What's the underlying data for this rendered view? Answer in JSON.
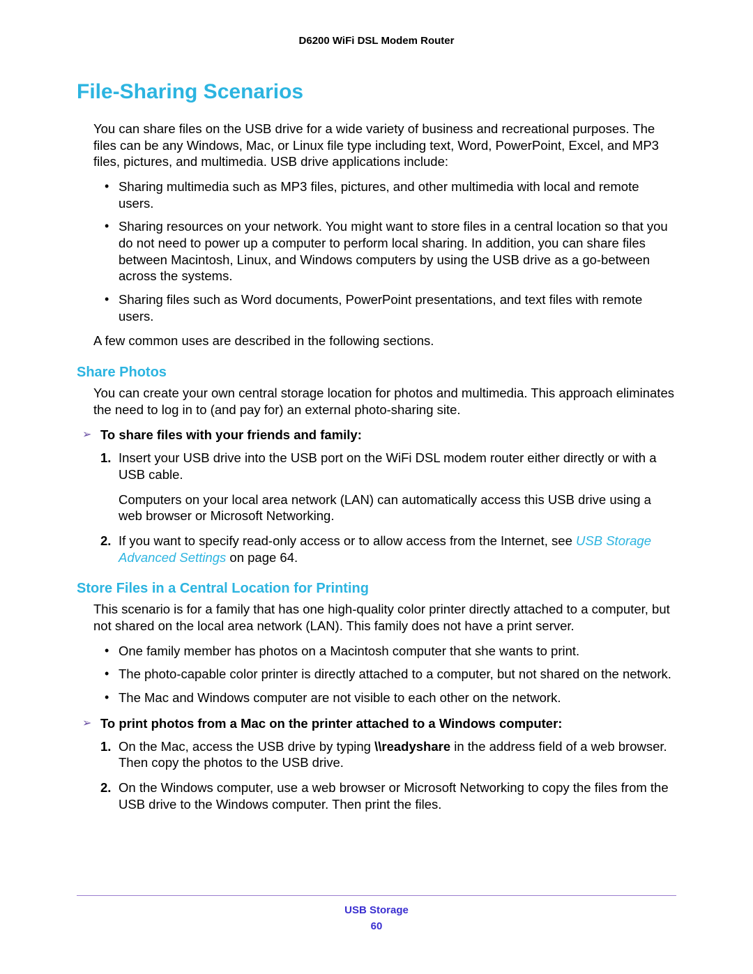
{
  "header": {
    "product": "D6200 WiFi DSL Modem Router"
  },
  "section": {
    "title": "File-Sharing Scenarios",
    "intro": "You can share files on the USB drive for a wide variety of business and recreational purposes. The files can be any Windows, Mac, or Linux file type including text, Word, PowerPoint, Excel, and MP3 files, pictures, and multimedia. USB drive applications include:",
    "bullets": [
      "Sharing multimedia such as MP3 files, pictures, and other multimedia with local and remote users.",
      "Sharing resources on your network. You might want to store files in a central location so that you do not need to power up a computer to perform local sharing. In addition, you can share files between Macintosh, Linux, and Windows computers by using the USB drive as a go-between across the systems.",
      "Sharing files such as Word documents, PowerPoint presentations, and text files with remote users."
    ],
    "outro": "A few common uses are described in the following sections."
  },
  "share_photos": {
    "title": "Share Photos",
    "intro": "You can create your own central storage location for photos and multimedia. This approach eliminates the need to log in to (and pay for) an external photo-sharing site.",
    "task_title": "To share files with your friends and family:",
    "step1": "Insert your USB drive into the USB port on the WiFi DSL modem router either directly or with a USB cable.",
    "step1_sub": "Computers on your local area network (LAN) can automatically access this USB drive using a web browser or Microsoft Networking.",
    "step2_pre": "If you want to specify read-only access or to allow access from the Internet, see ",
    "step2_link": "USB Storage Advanced Settings",
    "step2_post": " on page 64."
  },
  "store_files": {
    "title": "Store Files in a Central Location for Printing",
    "intro": "This scenario is for a family that has one high-quality color printer directly attached to a computer, but not shared on the local area network (LAN). This family does not have a print server.",
    "bullets": [
      "One family member has photos on a Macintosh computer that she wants to print.",
      "The photo-capable color printer is directly attached to a computer, but not shared on the network.",
      "The Mac and Windows computer are not visible to each other on the network."
    ],
    "task_title": "To print photos from a Mac on the printer attached to a Windows computer:",
    "step1_pre": "On the Mac, access the USB drive by typing ",
    "step1_cmd": "\\\\readyshare",
    "step1_post": " in the address field of a web browser. Then copy the photos to the USB drive.",
    "step2": "On the Windows computer, use a web browser or Microsoft Networking to copy the files from the USB drive to the Windows computer. Then print the files."
  },
  "footer": {
    "section": "USB Storage",
    "page": "60"
  }
}
